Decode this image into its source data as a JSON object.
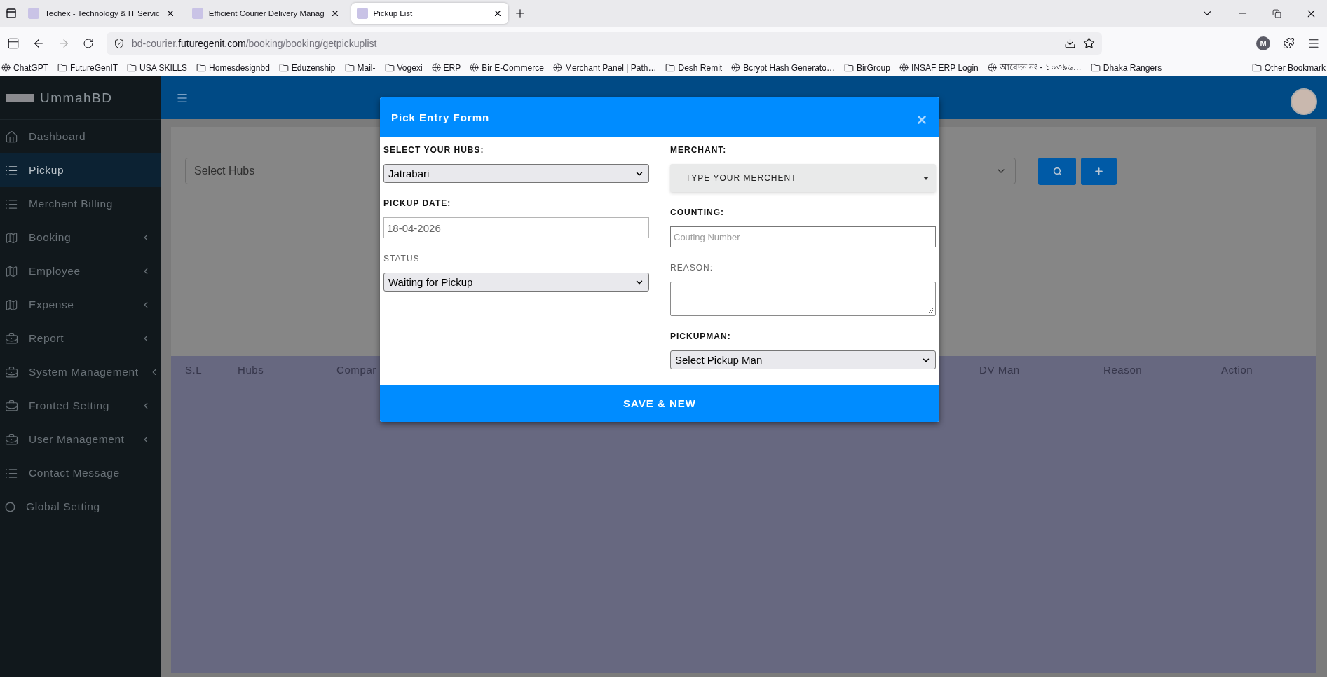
{
  "browser": {
    "tabs": [
      {
        "title": "Techex - Technology & IT Servic",
        "selected": false
      },
      {
        "title": "Efficient Courier Delivery Manag",
        "selected": false
      },
      {
        "title": "Pickup List",
        "selected": true
      }
    ],
    "url": {
      "subdomain": "bd-courier.",
      "domain": "futuregenit.com",
      "path": "/booking/booking/getpickuplist"
    },
    "profile_initial": "M",
    "bookmarks": [
      {
        "label": "ChatGPT",
        "kind": "site"
      },
      {
        "label": "FutureGenIT",
        "kind": "folder"
      },
      {
        "label": "USA SKILLS",
        "kind": "folder"
      },
      {
        "label": "Homesdesignbd",
        "kind": "folder"
      },
      {
        "label": "Eduzenship",
        "kind": "folder"
      },
      {
        "label": "Mail-",
        "kind": "folder"
      },
      {
        "label": "Vogexi",
        "kind": "folder"
      },
      {
        "label": "ERP",
        "kind": "site"
      },
      {
        "label": "Bir E-Commerce",
        "kind": "site"
      },
      {
        "label": "Merchant Panel | Path…",
        "kind": "site"
      },
      {
        "label": "Desh Remit",
        "kind": "folder"
      },
      {
        "label": "Bcrypt Hash Generato…",
        "kind": "site"
      },
      {
        "label": "BirGroup",
        "kind": "folder"
      },
      {
        "label": "INSAF ERP Login",
        "kind": "site"
      },
      {
        "label": "আবেদন নং - ১০৩৯৬…",
        "kind": "site"
      },
      {
        "label": "Dhaka Rangers",
        "kind": "folder"
      }
    ],
    "other_bookmarks": "Other Bookmark"
  },
  "sidebar": {
    "brand": "UmmahBD",
    "items": [
      {
        "label": "Dashboard",
        "kind": "home",
        "selected": false,
        "submenu": false
      },
      {
        "label": "Pickup",
        "kind": "list",
        "selected": true,
        "submenu": false
      },
      {
        "label": "Merchent Billing",
        "kind": "list",
        "selected": false,
        "submenu": false
      },
      {
        "label": "Booking",
        "kind": "map",
        "selected": false,
        "submenu": true
      },
      {
        "label": "Employee",
        "kind": "map",
        "selected": false,
        "submenu": true
      },
      {
        "label": "Expense",
        "kind": "map",
        "selected": false,
        "submenu": true
      },
      {
        "label": "Report",
        "kind": "briefcase",
        "selected": false,
        "submenu": true
      },
      {
        "label": "System Management",
        "kind": "briefcase",
        "selected": false,
        "submenu": true
      },
      {
        "label": "Fronted Setting",
        "kind": "briefcase",
        "selected": false,
        "submenu": true
      },
      {
        "label": "User Management",
        "kind": "briefcase",
        "selected": false,
        "submenu": true
      },
      {
        "label": "Contact Message",
        "kind": "list",
        "selected": false,
        "submenu": false
      },
      {
        "label": "Global Setting",
        "kind": "circle",
        "selected": false,
        "submenu": false
      }
    ]
  },
  "filter": {
    "hubs_placeholder": "Select Hubs"
  },
  "table": {
    "columns": [
      "S.L",
      "Hubs",
      "Compar",
      "DV Man",
      "Reason",
      "Action"
    ]
  },
  "modal": {
    "title": "Pick Entry Formn",
    "left_fields": [
      {
        "label": "SELECT YOUR HUBS:",
        "strong": true,
        "kind": "select",
        "value": "Jatrabari"
      },
      {
        "label": "PICKUP DATE:",
        "strong": true,
        "kind": "date",
        "value": "18-04-2026"
      },
      {
        "label": "STATUS",
        "strong": false,
        "kind": "select",
        "value": "Waiting for Pickup"
      }
    ],
    "right_fields": [
      {
        "label": "MERCHANT:",
        "strong": true,
        "kind": "merchant",
        "value": "TYPE YOUR MERCHENT"
      },
      {
        "label": "COUNTING:",
        "strong": true,
        "kind": "input",
        "placeholder": "Couting Number"
      },
      {
        "label": "REASON:",
        "strong": false,
        "kind": "textarea"
      },
      {
        "label": "PICKUPMAN:",
        "strong": true,
        "kind": "select",
        "value": "Select Pickup Man"
      }
    ],
    "save_button": "SAVE & NEW"
  }
}
